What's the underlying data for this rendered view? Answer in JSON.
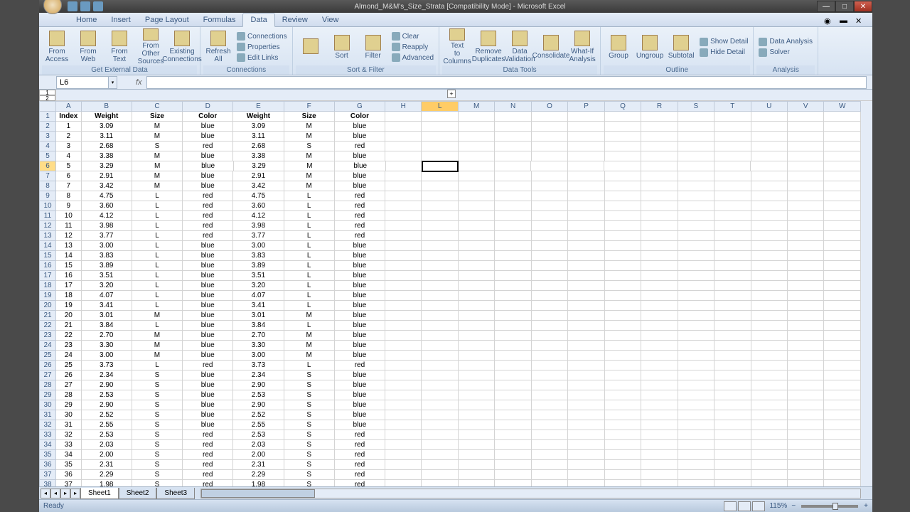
{
  "app": {
    "title": "Almond_M&M's_Size_Strata  [Compatibility Mode] - Microsoft Excel"
  },
  "tabs": [
    "Home",
    "Insert",
    "Page Layout",
    "Formulas",
    "Data",
    "Review",
    "View"
  ],
  "active_tab": "Data",
  "ribbon": {
    "g1": {
      "label": "Get External Data",
      "btns": [
        "From Access",
        "From Web",
        "From Text",
        "From Other Sources",
        "Existing Connections"
      ]
    },
    "g2": {
      "label": "Connections",
      "btn": "Refresh All",
      "items": [
        "Connections",
        "Properties",
        "Edit Links"
      ]
    },
    "g3": {
      "label": "Sort & Filter",
      "sort": "Sort",
      "filter": "Filter",
      "items": [
        "Clear",
        "Reapply",
        "Advanced"
      ]
    },
    "g4": {
      "label": "Data Tools",
      "btns": [
        "Text to Columns",
        "Remove Duplicates",
        "Data Validation",
        "Consolidate",
        "What-If Analysis"
      ]
    },
    "g5": {
      "label": "Outline",
      "btns": [
        "Group",
        "Ungroup",
        "Subtotal"
      ],
      "items": [
        "Show Detail",
        "Hide Detail"
      ]
    },
    "g6": {
      "label": "Analysis",
      "items": [
        "Data Analysis",
        "Solver"
      ]
    }
  },
  "name_box": "L6",
  "column_letters": [
    "A",
    "B",
    "C",
    "D",
    "E",
    "F",
    "G",
    "H",
    "L",
    "M",
    "N",
    "O",
    "P",
    "Q",
    "R",
    "S",
    "T",
    "U",
    "V",
    "W"
  ],
  "active_col": "L",
  "active_row": 6,
  "selected_cell": {
    "row": 6,
    "col": "L"
  },
  "headers": [
    "Index",
    "Weight",
    "Size",
    "Color",
    "Weight",
    "Size",
    "Color"
  ],
  "rows": [
    [
      1,
      "3.09",
      "M",
      "blue",
      "3.09",
      "M",
      "blue"
    ],
    [
      2,
      "3.11",
      "M",
      "blue",
      "3.11",
      "M",
      "blue"
    ],
    [
      3,
      "2.68",
      "S",
      "red",
      "2.68",
      "S",
      "red"
    ],
    [
      4,
      "3.38",
      "M",
      "blue",
      "3.38",
      "M",
      "blue"
    ],
    [
      5,
      "3.29",
      "M",
      "blue",
      "3.29",
      "M",
      "blue"
    ],
    [
      6,
      "2.91",
      "M",
      "blue",
      "2.91",
      "M",
      "blue"
    ],
    [
      7,
      "3.42",
      "M",
      "blue",
      "3.42",
      "M",
      "blue"
    ],
    [
      8,
      "4.75",
      "L",
      "red",
      "4.75",
      "L",
      "red"
    ],
    [
      9,
      "3.60",
      "L",
      "red",
      "3.60",
      "L",
      "red"
    ],
    [
      10,
      "4.12",
      "L",
      "red",
      "4.12",
      "L",
      "red"
    ],
    [
      11,
      "3.98",
      "L",
      "red",
      "3.98",
      "L",
      "red"
    ],
    [
      12,
      "3.77",
      "L",
      "red",
      "3.77",
      "L",
      "red"
    ],
    [
      13,
      "3.00",
      "L",
      "blue",
      "3.00",
      "L",
      "blue"
    ],
    [
      14,
      "3.83",
      "L",
      "blue",
      "3.83",
      "L",
      "blue"
    ],
    [
      15,
      "3.89",
      "L",
      "blue",
      "3.89",
      "L",
      "blue"
    ],
    [
      16,
      "3.51",
      "L",
      "blue",
      "3.51",
      "L",
      "blue"
    ],
    [
      17,
      "3.20",
      "L",
      "blue",
      "3.20",
      "L",
      "blue"
    ],
    [
      18,
      "4.07",
      "L",
      "blue",
      "4.07",
      "L",
      "blue"
    ],
    [
      19,
      "3.41",
      "L",
      "blue",
      "3.41",
      "L",
      "blue"
    ],
    [
      20,
      "3.01",
      "M",
      "blue",
      "3.01",
      "M",
      "blue"
    ],
    [
      21,
      "3.84",
      "L",
      "blue",
      "3.84",
      "L",
      "blue"
    ],
    [
      22,
      "2.70",
      "M",
      "blue",
      "2.70",
      "M",
      "blue"
    ],
    [
      23,
      "3.30",
      "M",
      "blue",
      "3.30",
      "M",
      "blue"
    ],
    [
      24,
      "3.00",
      "M",
      "blue",
      "3.00",
      "M",
      "blue"
    ],
    [
      25,
      "3.73",
      "L",
      "red",
      "3.73",
      "L",
      "red"
    ],
    [
      26,
      "2.34",
      "S",
      "blue",
      "2.34",
      "S",
      "blue"
    ],
    [
      27,
      "2.90",
      "S",
      "blue",
      "2.90",
      "S",
      "blue"
    ],
    [
      28,
      "2.53",
      "S",
      "blue",
      "2.53",
      "S",
      "blue"
    ],
    [
      29,
      "2.90",
      "S",
      "blue",
      "2.90",
      "S",
      "blue"
    ],
    [
      30,
      "2.52",
      "S",
      "blue",
      "2.52",
      "S",
      "blue"
    ],
    [
      31,
      "2.55",
      "S",
      "blue",
      "2.55",
      "S",
      "blue"
    ],
    [
      32,
      "2.53",
      "S",
      "red",
      "2.53",
      "S",
      "red"
    ],
    [
      33,
      "2.03",
      "S",
      "red",
      "2.03",
      "S",
      "red"
    ],
    [
      34,
      "2.00",
      "S",
      "red",
      "2.00",
      "S",
      "red"
    ],
    [
      35,
      "2.31",
      "S",
      "red",
      "2.31",
      "S",
      "red"
    ],
    [
      36,
      "2.29",
      "S",
      "red",
      "2.29",
      "S",
      "red"
    ],
    [
      37,
      "1.98",
      "S",
      "red",
      "1.98",
      "S",
      "red"
    ]
  ],
  "sheets": [
    "Sheet1",
    "Sheet2",
    "Sheet3"
  ],
  "active_sheet": 0,
  "status": "Ready",
  "zoom": "115%"
}
